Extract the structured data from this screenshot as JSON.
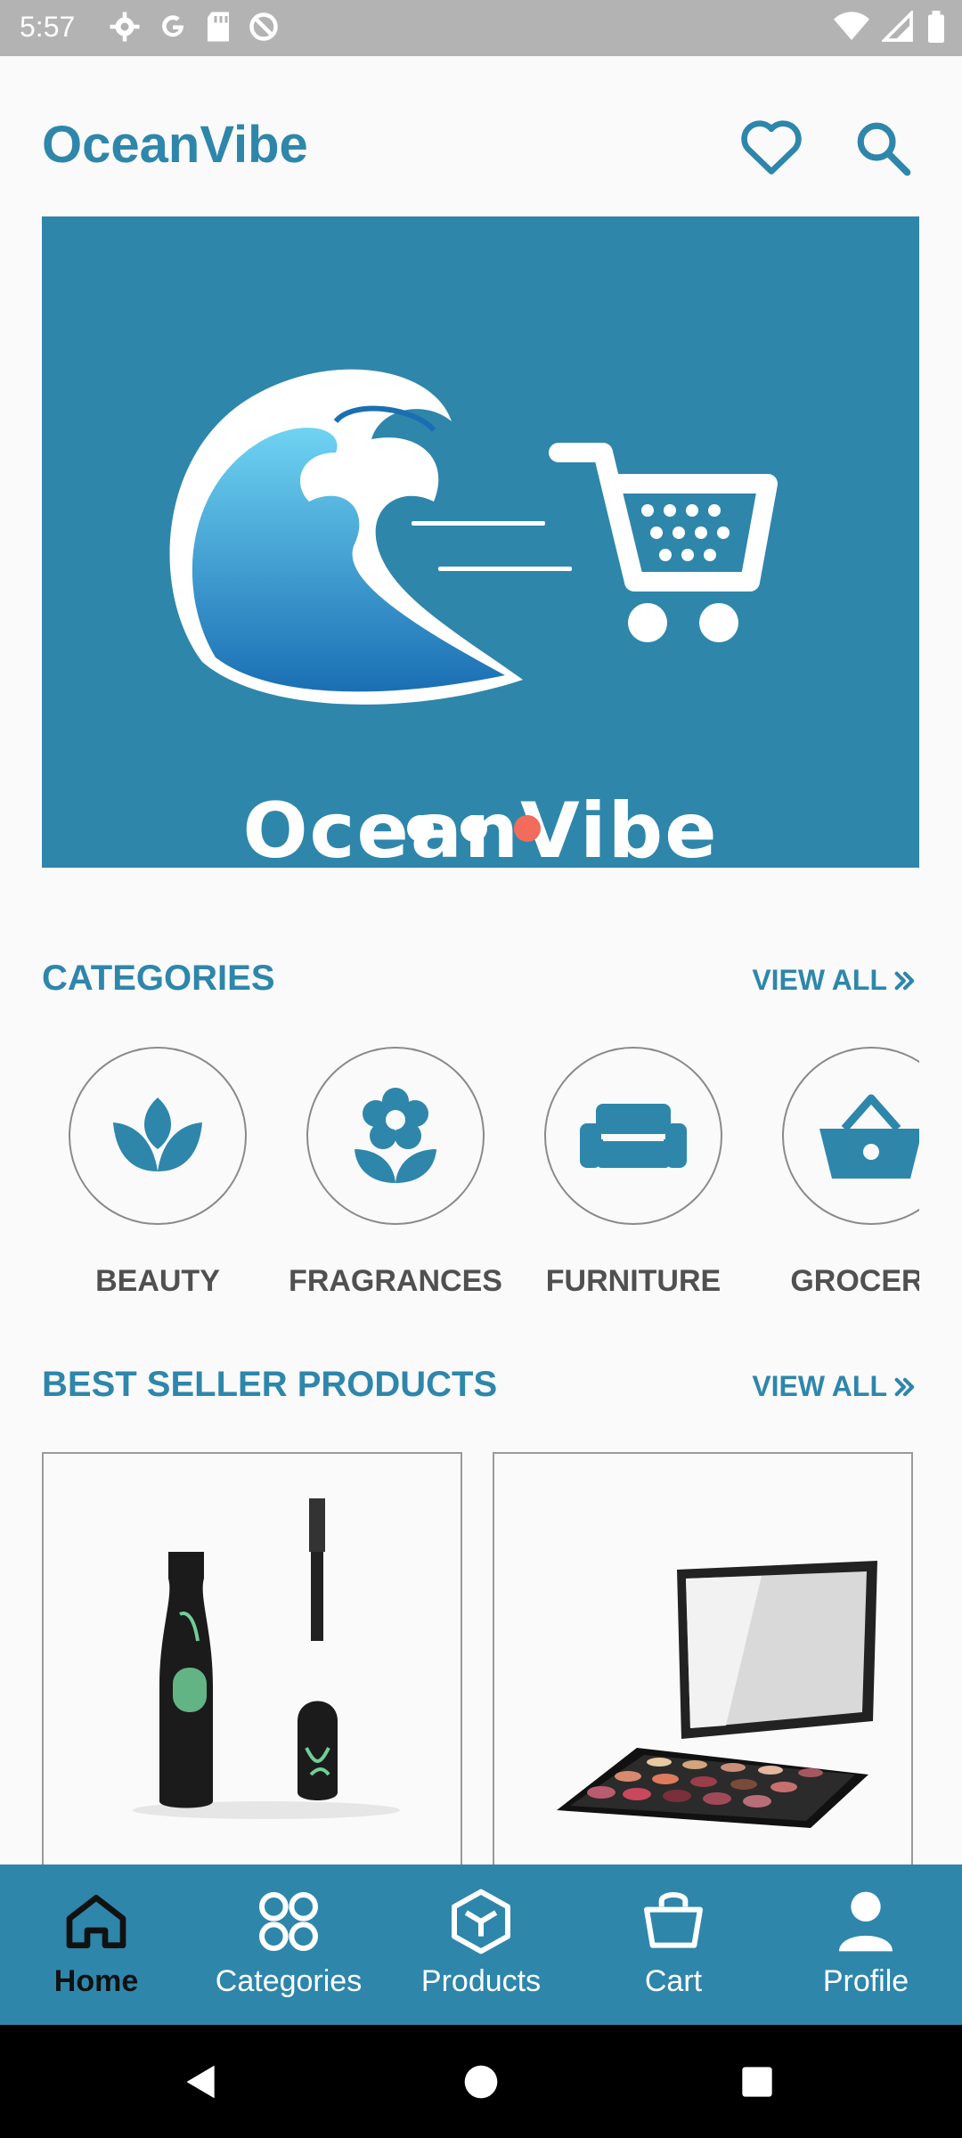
{
  "status_bar": {
    "time": "5:57"
  },
  "app_bar": {
    "brand": "OceanVibe"
  },
  "banner": {
    "brand_text": "OceanVibe",
    "slide_count": 3,
    "active_slide": 3
  },
  "categories": {
    "title": "CATEGORIES",
    "view_all": "VIEW ALL",
    "items": [
      {
        "label": "BEAUTY"
      },
      {
        "label": "FRAGRANCES"
      },
      {
        "label": "FURNITURE"
      },
      {
        "label": "GROCERIE"
      }
    ]
  },
  "best_sellers": {
    "title": "BEST SELLER PRODUCTS",
    "view_all": "VIEW ALL"
  },
  "bottom_nav": {
    "items": [
      {
        "label": "Home"
      },
      {
        "label": "Categories"
      },
      {
        "label": "Products"
      },
      {
        "label": "Cart"
      },
      {
        "label": "Profile"
      }
    ]
  },
  "colors": {
    "primary": "#2e86ab",
    "accent_dot": "#f26b5b"
  }
}
